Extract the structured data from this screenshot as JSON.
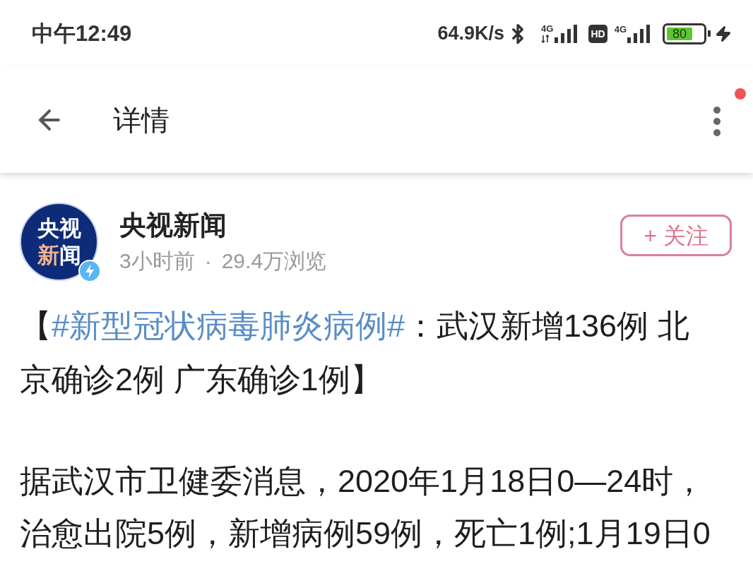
{
  "status_bar": {
    "time": "中午12:49",
    "net_speed": "64.9K/s",
    "sim_1": {
      "network": "4G"
    },
    "hd": "HD",
    "sim_2": {
      "network": "4G"
    },
    "battery": "80",
    "charging": true
  },
  "header": {
    "title": "详情",
    "menu_badge": true
  },
  "post": {
    "author": {
      "logo_lines": [
        [
          {
            "text": "央视",
            "color": "#ffffff"
          }
        ],
        [
          {
            "text": "新",
            "color": "#f2b48e"
          },
          {
            "text": "闻",
            "color": "#ffffff"
          }
        ]
      ],
      "verified": true,
      "name": "央视新闻",
      "time": "3小时前",
      "separator": "·",
      "views": "29.4万浏览"
    },
    "follow_button": "+ 关注",
    "headline": {
      "open": "【",
      "hashtag": "#新型冠状病毒肺炎病例#",
      "text": "：武汉新增136例 北京确诊2例 广东确诊1例】"
    },
    "paragraphs": [
      "据武汉市卫健委消息，2020年1月18日0—24时，治愈出院5例，新增病例59例，死亡1例;1月19日0"
    ]
  }
}
